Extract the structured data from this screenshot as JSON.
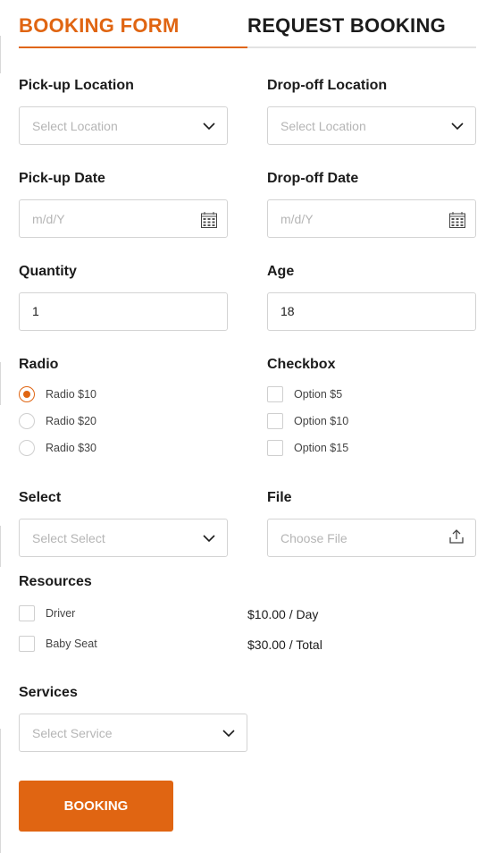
{
  "tabs": {
    "booking_form": "BOOKING FORM",
    "request_booking": "REQUEST BOOKING"
  },
  "pickup_location": {
    "label": "Pick-up Location",
    "placeholder": "Select Location"
  },
  "dropoff_location": {
    "label": "Drop-off Location",
    "placeholder": "Select Location"
  },
  "pickup_date": {
    "label": "Pick-up Date",
    "placeholder": "m/d/Y"
  },
  "dropoff_date": {
    "label": "Drop-off Date",
    "placeholder": "m/d/Y"
  },
  "quantity": {
    "label": "Quantity",
    "value": "1"
  },
  "age": {
    "label": "Age",
    "value": "18"
  },
  "radio": {
    "label": "Radio",
    "options": [
      "Radio $10",
      "Radio $20",
      "Radio $30"
    ],
    "selected_index": 0
  },
  "checkbox": {
    "label": "Checkbox",
    "options": [
      "Option $5",
      "Option $10",
      "Option $15"
    ]
  },
  "select": {
    "label": "Select",
    "placeholder": "Select Select"
  },
  "file": {
    "label": "File",
    "placeholder": "Choose File"
  },
  "resources": {
    "label": "Resources",
    "items": [
      {
        "name": "Driver",
        "price": "$10.00 / Day"
      },
      {
        "name": "Baby Seat",
        "price": "$30.00 / Total"
      }
    ]
  },
  "services": {
    "label": "Services",
    "placeholder": "Select Service"
  },
  "submit": {
    "label": "BOOKING"
  },
  "colors": {
    "accent": "#e06512",
    "border": "#d3d3d3",
    "placeholder": "#b5b5b5"
  },
  "icons": {
    "dropdown": "chevron-down-icon",
    "date": "calendar-icon",
    "file": "upload-icon"
  }
}
